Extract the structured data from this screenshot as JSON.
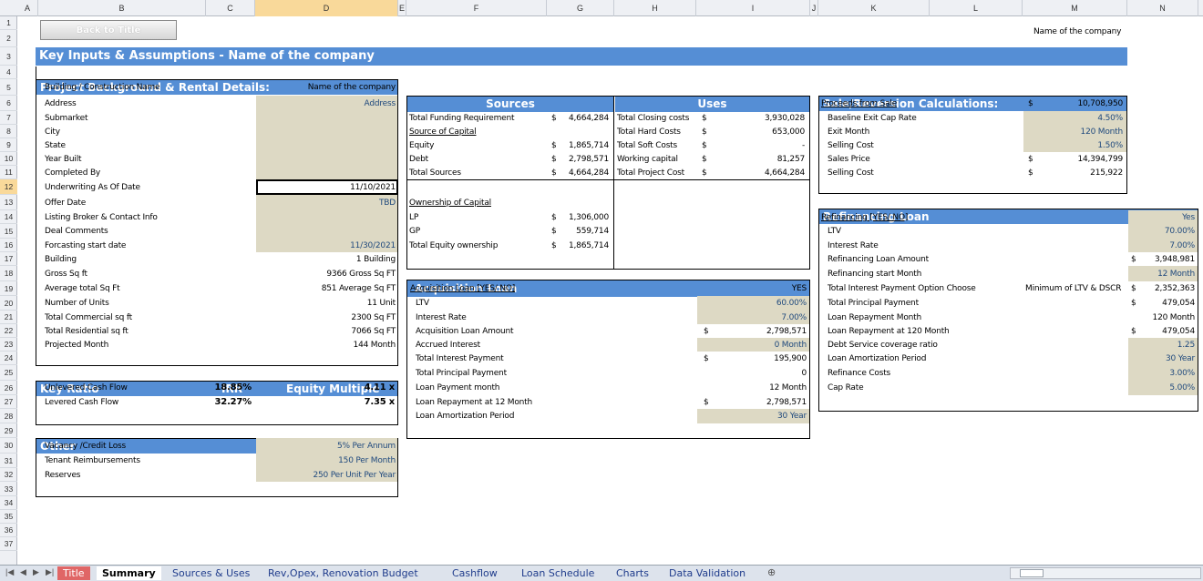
{
  "columns": [
    {
      "l": "A"
    },
    {
      "l": "B"
    },
    {
      "l": "C"
    },
    {
      "l": "D"
    },
    {
      "l": "E"
    },
    {
      "l": "F"
    },
    {
      "l": "G"
    },
    {
      "l": "H"
    },
    {
      "l": "I"
    },
    {
      "l": "J"
    },
    {
      "l": "K"
    },
    {
      "l": "L"
    },
    {
      "l": "M"
    },
    {
      "l": "N"
    }
  ],
  "selected_cell": "D12",
  "back_button": "Back to Title",
  "company_name_top": "Name of the company",
  "title": "Key Inputs & Assumptions - Name of the company",
  "project": {
    "header": "Project Background & Rental Details:",
    "rows": [
      {
        "label": "Building / Construction Name",
        "value": "Name of the company"
      },
      {
        "label": "Address",
        "value": "Address"
      },
      {
        "label": "Submarket",
        "value": ""
      },
      {
        "label": "City",
        "value": ""
      },
      {
        "label": "State",
        "value": ""
      },
      {
        "label": "Year Built",
        "value": ""
      },
      {
        "label": "Completed By",
        "value": ""
      },
      {
        "label": "Underwriting As Of Date",
        "value": "11/10/2021"
      },
      {
        "label": "Offer Date",
        "value": "TBD"
      },
      {
        "label": "Listing Broker & Contact Info",
        "value": ""
      },
      {
        "label": "Deal Comments",
        "value": ""
      },
      {
        "label": "Forcasting start date",
        "value": "11/30/2021"
      },
      {
        "label": "Building",
        "value": "1 Building"
      },
      {
        "label": "Gross Sq ft",
        "value": "9366 Gross Sq FT"
      },
      {
        "label": "Average total Sq Ft",
        "value": "851 Average Sq FT"
      },
      {
        "label": "Number of Units",
        "value": "11 Unit"
      },
      {
        "label": "Total Commercial sq ft",
        "value": "2300 Sq FT"
      },
      {
        "label": "Total Residential sq ft",
        "value": "7066 Sq FT"
      },
      {
        "label": "Projected Month",
        "value": "144 Month"
      }
    ]
  },
  "key_ratio": {
    "header": "Key Ratio",
    "irr_header": "IRR",
    "em_header": "Equity Multiple",
    "rows": [
      {
        "label": "Unlevered Cash Flow",
        "irr": "18.85%",
        "em": "4.11 x"
      },
      {
        "label": "Levered Cash Flow",
        "irr": "32.27%",
        "em": "7.35 x"
      }
    ]
  },
  "other": {
    "header": "Other",
    "rows": [
      {
        "label": "Vacancy /Credit Loss",
        "value": "5% Per Annum"
      },
      {
        "label": "Tenant Reimbursements",
        "value": "150 Per Month"
      },
      {
        "label": "Reserves",
        "value": "250 Per Unit Per Year"
      }
    ]
  },
  "sources": {
    "header": "Sources",
    "rows": [
      {
        "label": "Total Funding Requirement",
        "cur": "$",
        "value": "4,664,284"
      },
      {
        "label": "Source of Capital",
        "cur": "",
        "value": ""
      },
      {
        "label": "Equity",
        "cur": "$",
        "value": "1,865,714"
      },
      {
        "label": "Debt",
        "cur": "$",
        "value": "2,798,571"
      },
      {
        "label": "Total Sources",
        "cur": "$",
        "value": "4,664,284"
      }
    ],
    "ownership_label": "Ownership of Capital",
    "ownership": [
      {
        "label": "LP",
        "cur": "$",
        "value": "1,306,000"
      },
      {
        "label": "GP",
        "cur": "$",
        "value": "559,714"
      },
      {
        "label": "Total Equity ownership",
        "cur": "$",
        "value": "1,865,714"
      }
    ]
  },
  "uses": {
    "header": "Uses",
    "rows": [
      {
        "label": "Total Closing costs",
        "cur": "$",
        "value": "3,930,028"
      },
      {
        "label": "Total Hard Costs",
        "cur": "$",
        "value": "653,000"
      },
      {
        "label": "Total Soft Costs",
        "cur": "$",
        "value": "-"
      },
      {
        "label": "Working capital",
        "cur": "$",
        "value": "81,257"
      },
      {
        "label": "Total Project Cost",
        "cur": "$",
        "value": "4,664,284"
      }
    ]
  },
  "acq": {
    "header": "Acquisition Loan",
    "rows": [
      {
        "label": "Acquisition Loan [YES/ NO]",
        "cur": "",
        "value": "YES"
      },
      {
        "label": "LTV",
        "cur": "",
        "value": "60.00%"
      },
      {
        "label": "Interest Rate",
        "cur": "",
        "value": "7.00%"
      },
      {
        "label": "Acquisition Loan Amount",
        "cur": "$",
        "value": "2,798,571"
      },
      {
        "label": "Accrued Interest",
        "cur": "",
        "value": "0 Month"
      },
      {
        "label": "Total Interest Payment",
        "cur": "$",
        "value": "195,900"
      },
      {
        "label": "Total Principal Payment",
        "cur": "",
        "value": "0"
      },
      {
        "label": "Loan Payment month",
        "cur": "",
        "value": "12 Month"
      },
      {
        "label": "Loan Repayment at 12 Month",
        "cur": "$",
        "value": "2,798,571"
      },
      {
        "label": "Loan Amortization Period",
        "cur": "",
        "value": "30 Year"
      }
    ]
  },
  "sale": {
    "header": "Sale/Reversion Calculations:",
    "rows": [
      {
        "label": "Proceeds from Sale",
        "cur": "$",
        "value": "10,708,950"
      },
      {
        "label": "Baseline Exit Cap Rate",
        "cur": "",
        "value": "4.50%"
      },
      {
        "label": "Exit Month",
        "cur": "",
        "value": "120 Month"
      },
      {
        "label": "Selling Cost",
        "cur": "",
        "value": "1.50%"
      },
      {
        "label": "Sales Price",
        "cur": "$",
        "value": "14,394,799"
      },
      {
        "label": "Selling Cost",
        "cur": "$",
        "value": "215,922"
      }
    ]
  },
  "refi": {
    "header": "Refinancing Loan",
    "rows": [
      {
        "label": "Refinancing [YES/ NO]",
        "cur": "",
        "value": "Yes"
      },
      {
        "label": "LTV",
        "cur": "",
        "value": "70.00%"
      },
      {
        "label": "Interest Rate",
        "cur": "",
        "value": "7.00%"
      },
      {
        "label": "Refinancing Loan Amount",
        "cur": "$",
        "value": "3,948,981"
      },
      {
        "label": "Refinancing start Month",
        "cur": "",
        "value": "12 Month"
      },
      {
        "label": "Total Interest Payment  Option Choose",
        "cur": "$",
        "value": "2,352,363",
        "extra": "Minimum of LTV & DSCR"
      },
      {
        "label": "Total Principal Payment",
        "cur": "$",
        "value": "479,054"
      },
      {
        "label": "Loan Repayment Month",
        "cur": "",
        "value": "120 Month"
      },
      {
        "label": "Loan Repayment at 120 Month",
        "cur": "$",
        "value": "479,054"
      },
      {
        "label": "Debt Service coverage ratio",
        "cur": "",
        "value": "1.25"
      },
      {
        "label": "Loan Amortization Period",
        "cur": "",
        "value": "30 Year"
      },
      {
        "label": "Refinance Costs",
        "cur": "",
        "value": "3.00%"
      },
      {
        "label": "Cap Rate",
        "cur": "",
        "value": "5.00%"
      }
    ]
  },
  "sheet_tabs": [
    "Title",
    "Summary",
    "Sources & Uses",
    "Rev,Opex, Renovation Budget",
    "Cashflow",
    "Loan Schedule",
    "Charts",
    "Data Validation"
  ]
}
